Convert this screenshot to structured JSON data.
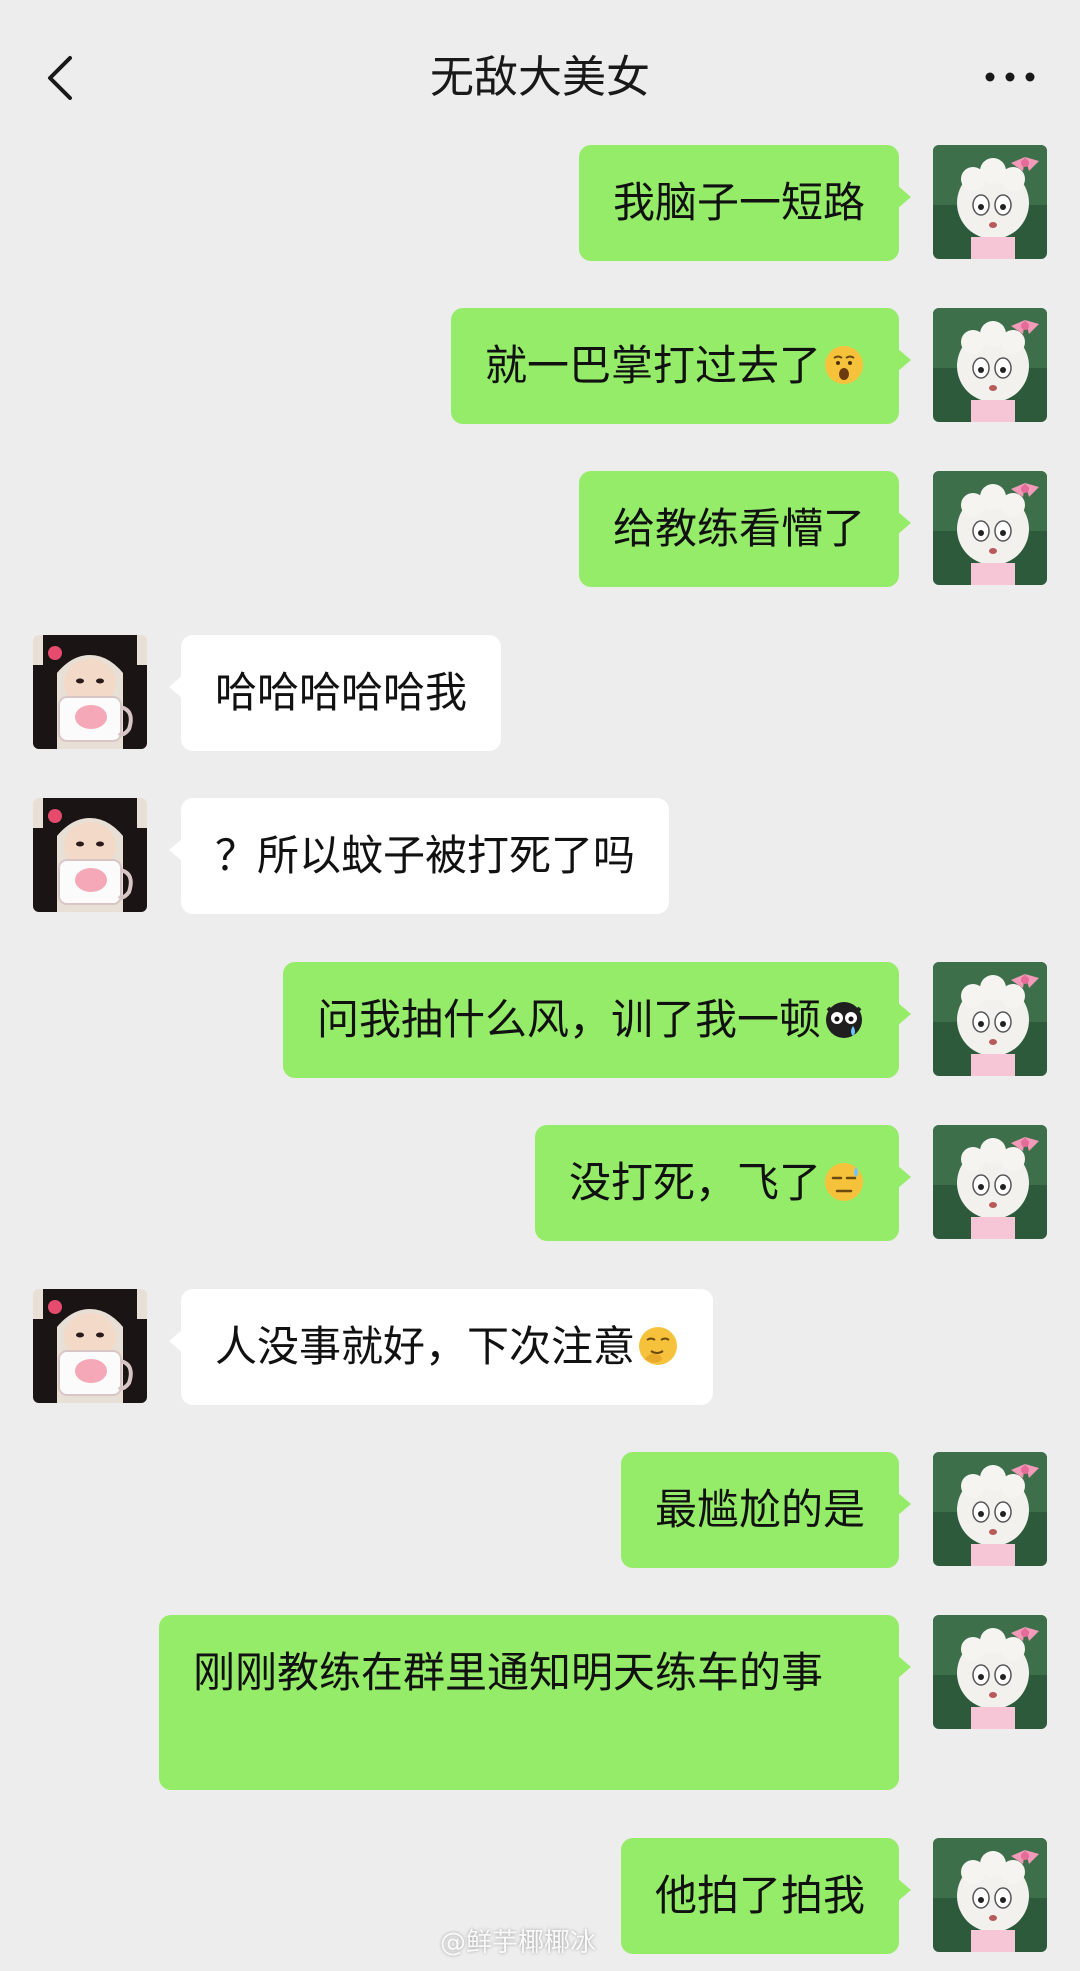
{
  "header": {
    "title": "无敌大美女",
    "back_icon": "chevron-left-icon",
    "more_icon": "more-dots-icon"
  },
  "colors": {
    "background": "#ededed",
    "self_bubble": "#95ec69",
    "other_bubble": "#ffffff"
  },
  "messages": [
    {
      "sender": "self",
      "text": "我脑子一短路"
    },
    {
      "sender": "self",
      "text": "就一巴掌打过去了",
      "emoji": "shocked-face-emoji"
    },
    {
      "sender": "self",
      "text": "给教练看懵了"
    },
    {
      "sender": "other",
      "text": "哈哈哈哈哈我"
    },
    {
      "sender": "other",
      "text": "？所以蚊子被打死了吗"
    },
    {
      "sender": "self",
      "text": "问我抽什么风，训了我一顿",
      "emoji": "crying-black-face-emoji"
    },
    {
      "sender": "self",
      "text": "没打死，飞了",
      "emoji": "sweat-face-emoji"
    },
    {
      "sender": "other",
      "text": "人没事就好，下次注意",
      "emoji": "thinking-face-emoji"
    },
    {
      "sender": "self",
      "text": "最尴尬的是"
    },
    {
      "sender": "self",
      "text": "刚刚教练在群里通知明天练车的事"
    },
    {
      "sender": "self",
      "text": "他拍了拍我"
    }
  ],
  "watermark": "@鲜芋椰椰冰"
}
